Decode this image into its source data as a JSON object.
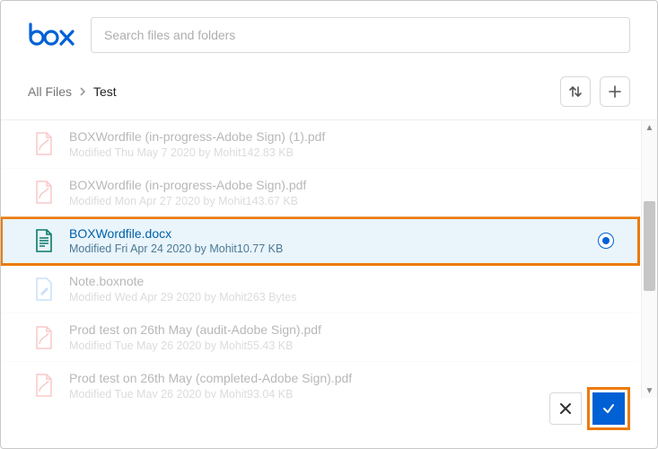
{
  "logo_text": "box",
  "search": {
    "placeholder": "Search files and folders",
    "value": ""
  },
  "breadcrumb": {
    "root": "All Files",
    "current": "Test"
  },
  "files": [
    {
      "name": "BOXWordfile (in-progress-Adobe Sign) (1).pdf",
      "meta": "Modified Thu May 7 2020 by Mohit142.83 KB",
      "kind": "pdf",
      "selected": false
    },
    {
      "name": "BOXWordfile (in-progress-Adobe Sign).pdf",
      "meta": "Modified Mon Apr 27 2020 by Mohit143.67 KB",
      "kind": "pdf",
      "selected": false
    },
    {
      "name": "BOXWordfile.docx",
      "meta": "Modified Fri Apr 24 2020 by Mohit10.77 KB",
      "kind": "doc",
      "selected": true
    },
    {
      "name": "Note.boxnote",
      "meta": "Modified Wed Apr 29 2020 by Mohit263 Bytes",
      "kind": "note",
      "selected": false
    },
    {
      "name": "Prod test on 26th May (audit-Adobe Sign).pdf",
      "meta": "Modified Tue May 26 2020 by Mohit55.43 KB",
      "kind": "pdf",
      "selected": false
    },
    {
      "name": "Prod test on 26th May (completed-Adobe Sign).pdf",
      "meta": "Modified Tue May 26 2020 by Mohit93.04 KB",
      "kind": "pdf",
      "selected": false
    }
  ],
  "colors": {
    "accent": "#0061d5",
    "highlight": "#ec7a08"
  }
}
